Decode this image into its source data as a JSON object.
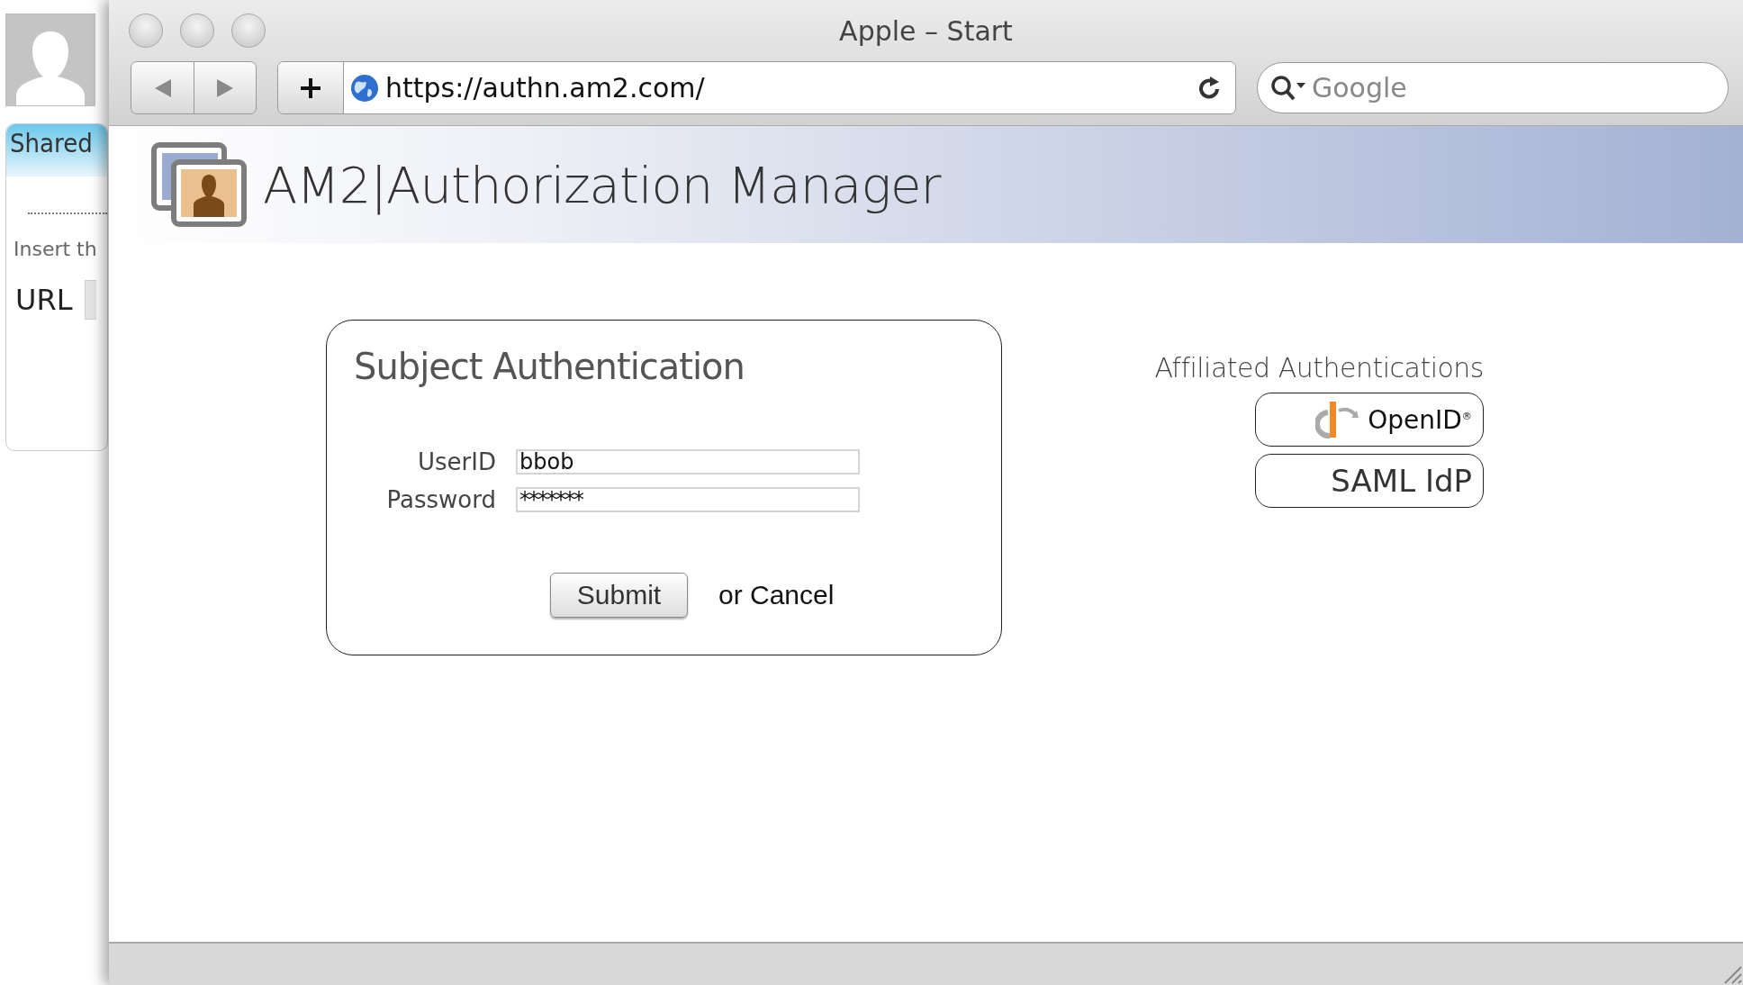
{
  "background_window": {
    "tab": "Shared",
    "instruction": "Insert th",
    "url_label": "URL"
  },
  "browser": {
    "title": "Apple – Start",
    "address": "https://authn.am2.com/",
    "search": {
      "placeholder": "Google"
    }
  },
  "header": {
    "title": "AM2|Authorization Manager"
  },
  "login": {
    "title": "Subject Authentication",
    "fields": [
      {
        "label": "UserID",
        "value": "bbob",
        "kind": "text"
      },
      {
        "label": "Password",
        "value": "*******",
        "kind": "password"
      }
    ],
    "submit": "Submit",
    "cancel": "or Cancel"
  },
  "affiliated": {
    "title": "Affiliated Authentications",
    "providers": [
      {
        "label": "OpenID$^{®}$",
        "kind": "openid"
      },
      {
        "label": "SAML IdP",
        "kind": "plain"
      }
    ]
  }
}
